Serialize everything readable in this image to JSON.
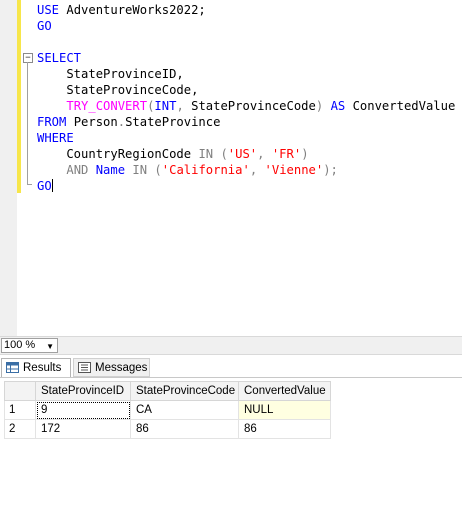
{
  "editor": {
    "lines": [
      [
        {
          "t": "USE ",
          "c": "kw"
        },
        {
          "t": "AdventureWorks2022;",
          "c": ""
        }
      ],
      [
        {
          "t": "GO",
          "c": "kw"
        }
      ],
      [],
      [
        {
          "t": "SELECT",
          "c": "kw"
        }
      ],
      [
        {
          "t": "    StateProvinceID,",
          "c": ""
        }
      ],
      [
        {
          "t": "    StateProvinceCode,",
          "c": ""
        }
      ],
      [
        {
          "t": "    ",
          "c": ""
        },
        {
          "t": "TRY_CONVERT",
          "c": "fn"
        },
        {
          "t": "(",
          "c": "op"
        },
        {
          "t": "INT",
          "c": "kw"
        },
        {
          "t": ", ",
          "c": "op"
        },
        {
          "t": "StateProvinceCode",
          "c": ""
        },
        {
          "t": ") ",
          "c": "op"
        },
        {
          "t": "AS ",
          "c": "kw"
        },
        {
          "t": "ConvertedValue",
          "c": ""
        }
      ],
      [
        {
          "t": "FROM ",
          "c": "kw"
        },
        {
          "t": "Person",
          "c": ""
        },
        {
          "t": ".",
          "c": "op"
        },
        {
          "t": "StateProvince",
          "c": ""
        }
      ],
      [
        {
          "t": "WHERE",
          "c": "kw"
        }
      ],
      [
        {
          "t": "    CountryRegionCode ",
          "c": ""
        },
        {
          "t": "IN ",
          "c": "op"
        },
        {
          "t": "(",
          "c": "op"
        },
        {
          "t": "'US'",
          "c": "str"
        },
        {
          "t": ", ",
          "c": "op"
        },
        {
          "t": "'FR'",
          "c": "str"
        },
        {
          "t": ")",
          "c": "op"
        }
      ],
      [
        {
          "t": "    ",
          "c": ""
        },
        {
          "t": "AND ",
          "c": "op"
        },
        {
          "t": "Name ",
          "c": "kw"
        },
        {
          "t": "IN ",
          "c": "op"
        },
        {
          "t": "(",
          "c": "op"
        },
        {
          "t": "'California'",
          "c": "str"
        },
        {
          "t": ", ",
          "c": "op"
        },
        {
          "t": "'Vienne'",
          "c": "str"
        },
        {
          "t": ");",
          "c": "op"
        }
      ],
      [
        {
          "t": "GO",
          "c": "kw"
        }
      ]
    ]
  },
  "statusbar": {
    "zoom": "100 %"
  },
  "tabs": {
    "results": "Results",
    "messages": "Messages"
  },
  "grid": {
    "columns": [
      "StateProvinceID",
      "StateProvinceCode",
      "ConvertedValue"
    ],
    "rows": [
      {
        "num": "1",
        "cells": [
          "9",
          "CA",
          "NULL"
        ]
      },
      {
        "num": "2",
        "cells": [
          "172",
          "86",
          "86"
        ]
      }
    ]
  }
}
